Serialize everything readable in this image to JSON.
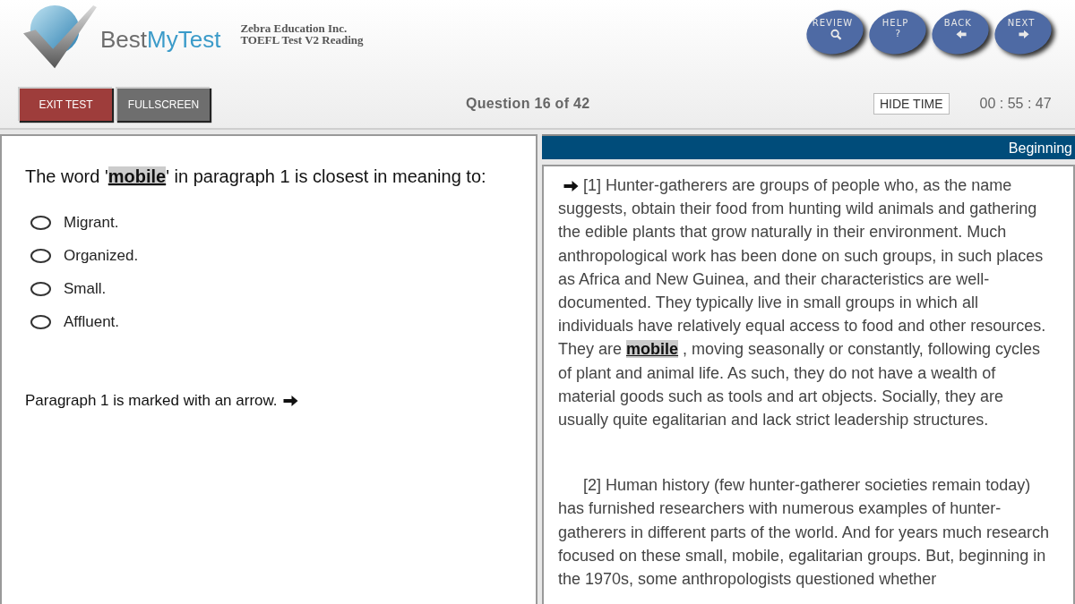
{
  "header": {
    "logo": {
      "part1": "Best",
      "part2": "MyTest"
    },
    "org": "Zebra Education Inc.",
    "test": "TOEFL Test V2 Reading",
    "nav_buttons": [
      {
        "label": "REVIEW",
        "kind": "review"
      },
      {
        "label": "HELP",
        "kind": "help",
        "glyph": "?"
      },
      {
        "label": "BACK",
        "kind": "back"
      },
      {
        "label": "NEXT",
        "kind": "next"
      }
    ]
  },
  "toolbar": {
    "buttons": [
      {
        "label": "EXIT TEST",
        "kind": "exit"
      },
      {
        "label": "FULLSCREEN",
        "kind": "plain"
      }
    ],
    "question_counter": "Question 16 of 42",
    "hide_time": "HIDE TIME",
    "timer": "00 : 55 : 47"
  },
  "question": {
    "prompt": "The word '**mobile**' in paragraph 1 is closest in meaning to:",
    "options": [
      {
        "label": "Migrant.",
        "selected": false
      },
      {
        "label": "Organized.",
        "selected": false
      },
      {
        "label": "Small.",
        "selected": false
      },
      {
        "label": "Affluent.",
        "selected": false
      }
    ],
    "note": "Paragraph 1 is marked with an arrow."
  },
  "passage": {
    "position_label": "Beginning",
    "paragraphs": [
      {
        "marked": true,
        "text": "[1] Hunter-gatherers are groups of people who, as the name suggests, obtain their food from hunting wild animals and gathering the edible plants that grow naturally in their environment. Much anthropological work has been done on such groups, in such places as Africa and New Guinea, and their characteristics are well-documented. They typically live in small groups in which all individuals have relatively equal access to food and other resources. They are **mobile** , moving seasonally or constantly, following cycles of plant and animal life. As such, they do not have a wealth of material goods such as tools and art objects. Socially, they are usually quite egalitarian and lack strict leadership structures."
      },
      {
        "marked": false,
        "text": "[2] Human history (few hunter-gatherer societies remain today) has furnished researchers with numerous examples of hunter-gatherers in different parts of the world. And for years much research focused on these small, mobile, egalitarian groups. But, beginning in the 1970s, some anthropologists questioned whether"
      }
    ]
  }
}
